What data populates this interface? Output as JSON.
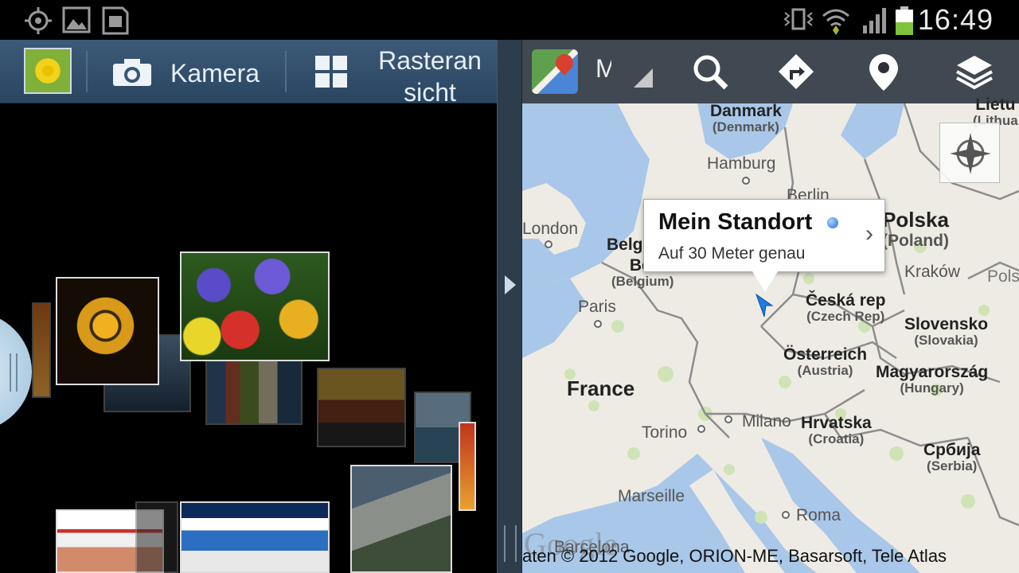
{
  "status_bar": {
    "time": "16:49",
    "icons": [
      "gps-icon",
      "gallery-notification-icon",
      "sd-card-icon",
      "vibrate-icon",
      "wifi-icon",
      "signal-icon",
      "battery-icon"
    ],
    "battery_level": 0.5
  },
  "gallery": {
    "action_bar": {
      "camera_label": "Kamera",
      "grid_label_line1": "Rasteran",
      "grid_label_line2": "sicht"
    }
  },
  "maps": {
    "title": "M",
    "callout": {
      "title": "Mein Standort",
      "subtitle": "Auf 30 Meter genau",
      "arrow": "›"
    },
    "countries": [
      {
        "name": "Danmark",
        "sub": "(Denmark)"
      },
      {
        "name": "Polska",
        "sub": "(Poland)"
      },
      {
        "name": "Belgi",
        "sub": ""
      },
      {
        "name": "Bel",
        "sub": "(Belgium)"
      },
      {
        "name": "Česká rep",
        "sub": "(Czech Rep)"
      },
      {
        "name": "Slovensko",
        "sub": "(Slovakia)"
      },
      {
        "name": "Österreich",
        "sub": "(Austria)"
      },
      {
        "name": "Magyarország",
        "sub": "(Hungary)"
      },
      {
        "name": "France",
        "sub": ""
      },
      {
        "name": "Hrvatska",
        "sub": "(Croatia)"
      },
      {
        "name": "Србија",
        "sub": "(Serbia)"
      },
      {
        "name": "Lietu",
        "sub": "(Lithua"
      }
    ],
    "cities": [
      "Hamburg",
      "Berlin",
      "London",
      "Paris",
      "Kraków",
      "Milano",
      "Torino",
      "Marseille",
      "Roma",
      "Barcelona",
      "Pols"
    ],
    "copyright": "aten © 2012 Google, ORION-ME, Basarsoft, Tele Atlas",
    "watermark": "Google",
    "colors": {
      "water": "#a9c7e8",
      "land": "#eeebe4",
      "park": "#cfe3b5",
      "border": "#8c8c8c",
      "action_bar": "#2c3035"
    }
  }
}
